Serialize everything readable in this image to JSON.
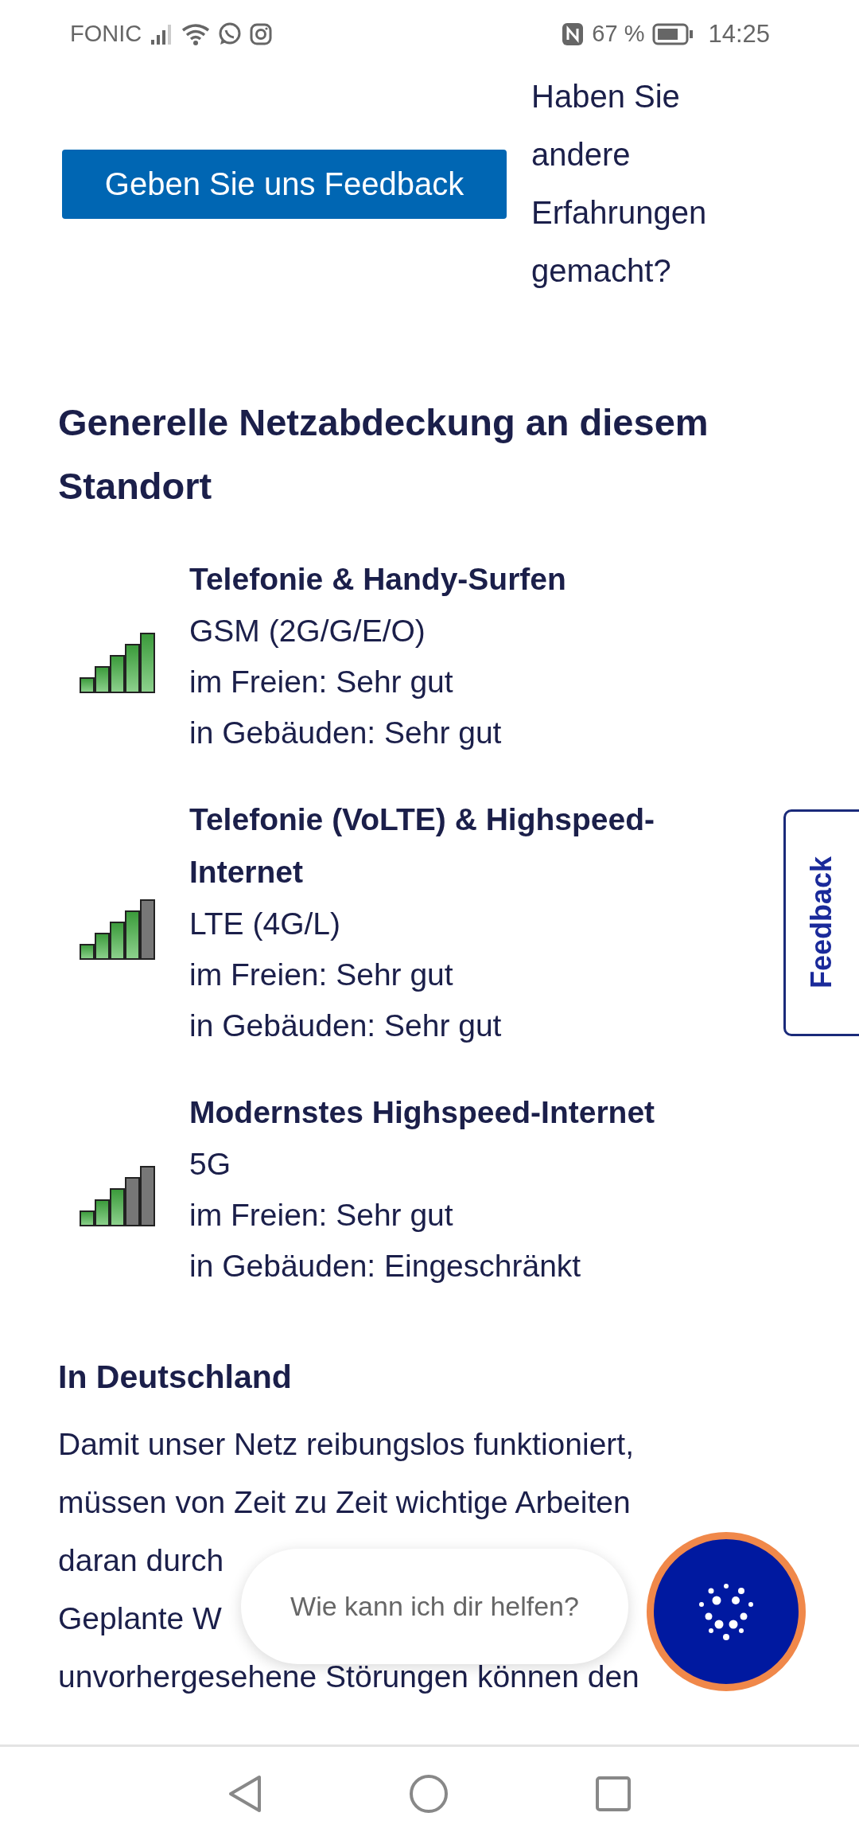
{
  "status_bar": {
    "carrier": "FONIC",
    "battery": "67 %",
    "time": "14:25"
  },
  "feedback_prompt": {
    "button": "Geben Sie uns Feedback",
    "text": "Haben Sie andere Erfahrungen gemacht?"
  },
  "coverage": {
    "heading": "Generelle Netzabdeckung an diesem Standort",
    "items": [
      {
        "title": "Telefonie & Handy-Surfen",
        "technology": "GSM (2G/G/E/O)",
        "outdoor": "im Freien: Sehr gut",
        "indoor": "in Gebäuden: Sehr gut",
        "level": 1
      },
      {
        "title": "Telefonie (VoLTE) & Highspeed-Internet",
        "technology": "LTE (4G/L)",
        "outdoor": "im Freien: Sehr gut",
        "indoor": "in Gebäuden: Sehr gut",
        "level": 0.8
      },
      {
        "title": "Modernstes Highspeed-Internet",
        "technology": "5G",
        "outdoor": "im Freien: Sehr gut",
        "indoor": "in Gebäuden: Eingeschränkt",
        "level": 0.6
      }
    ]
  },
  "germany": {
    "heading": "In Deutschland",
    "paragraphs": [
      {
        "lines": [
          "Damit unser Netz reibungslos funktioniert,",
          "müssen von Zeit zu Zeit wichtige Arbeiten",
          "daran durch"
        ]
      },
      {
        "lines": [
          "Geplante W",
          "unvorhergesehene Störungen können den"
        ]
      }
    ]
  },
  "feedback_tab": {
    "label": "Feedback"
  },
  "chat": {
    "placeholder": "Wie kann ich dir helfen?"
  }
}
